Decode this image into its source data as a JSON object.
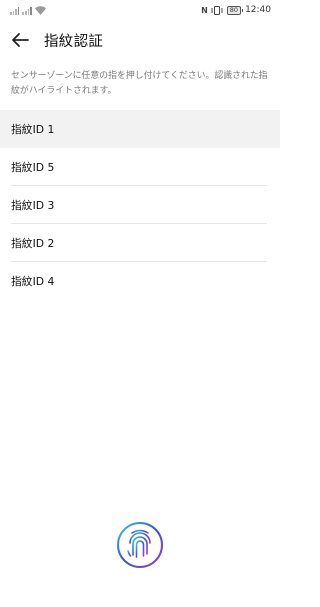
{
  "status_bar": {
    "time": "12:40",
    "nfc": "N",
    "battery": "80",
    "icons": [
      "signal-icon",
      "signal-icon",
      "wifi-icon",
      "nfc-icon",
      "vibrate-icon",
      "battery-icon"
    ]
  },
  "app_bar": {
    "back_icon": "back-arrow-icon",
    "title": "指紋認証"
  },
  "description": "センサーゾーンに任意の指を押し付けてください。認識された指紋がハイライトされます。",
  "fingerprints": [
    {
      "label": "指紋ID 1",
      "highlighted": true
    },
    {
      "label": "指紋ID 5",
      "highlighted": false
    },
    {
      "label": "指紋ID 3",
      "highlighted": false
    },
    {
      "label": "指紋ID 2",
      "highlighted": false
    },
    {
      "label": "指紋ID 4",
      "highlighted": false
    }
  ],
  "sensor_icon": "fingerprint-icon",
  "colors": {
    "highlight": "#f2f2f2",
    "description": "#7a7a7a",
    "fingerprint_gradient": [
      "#35c7e6",
      "#3a4fd6",
      "#9b3fd8"
    ]
  }
}
